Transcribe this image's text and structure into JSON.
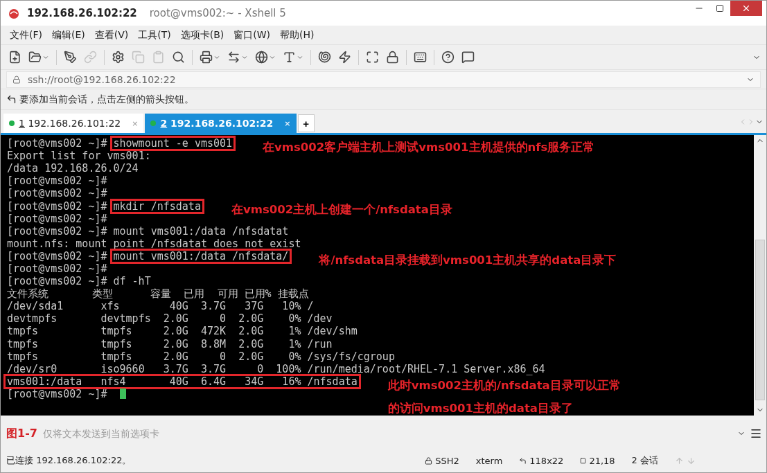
{
  "window": {
    "title": "192.168.26.102:22",
    "subtitle": "root@vms002:~ - Xshell 5"
  },
  "menu": [
    "文件(F)",
    "编辑(E)",
    "查看(V)",
    "工具(T)",
    "选项卡(B)",
    "窗口(W)",
    "帮助(H)"
  ],
  "address": {
    "value": "ssh://root@192.168.26.102:22"
  },
  "hint": "要添加当前会话，点击左侧的箭头按钮。",
  "tabs": [
    {
      "number": "1",
      "label": "192.168.26.101:22",
      "close": "×",
      "selected": false
    },
    {
      "number": "2",
      "label": "192.168.26.102:22",
      "close": "×",
      "selected": true
    }
  ],
  "add_tab": "+",
  "terminal": [
    {
      "prompt": "[root@vms002 ~]#",
      "command": "showmount -e vms001",
      "boxed": true,
      "note": [
        "在vms002客户端主机上测试vms001主机提供的nfs服务正常"
      ]
    },
    {
      "text": "Export list for vms001:",
      "boxed": false
    },
    {
      "text": "/data 192.168.26.0/24",
      "boxed": false
    },
    {
      "prompt": "[root@vms002 ~]#",
      "boxed": false
    },
    {
      "prompt": "[root@vms002 ~]#",
      "boxed": false
    },
    {
      "prompt": "[root@vms002 ~]#",
      "command": "mkdir /nfsdata",
      "boxed": true,
      "note": [
        "在vms002主机上创建一个/nfsdata目录"
      ]
    },
    {
      "prompt": "[root@vms002 ~]#",
      "boxed": false
    },
    {
      "prompt": "[root@vms002 ~]#",
      "command": "mount vms001:/data /nfsdatat",
      "boxed": false
    },
    {
      "text": "mount.nfs: mount point /nfsdatat does not exist",
      "boxed": false
    },
    {
      "prompt": "[root@vms002 ~]#",
      "command": "mount vms001:/data /nfsdata/",
      "boxed": true,
      "note": [
        "将/nfsdata目录挂载到vms001主机共享的data目录下"
      ]
    },
    {
      "prompt": "[root@vms002 ~]#",
      "boxed": false
    },
    {
      "prompt": "[root@vms002 ~]#",
      "command": "df -hT",
      "boxed": false
    },
    {
      "text": "文件系统       类型      容量  已用  可用 已用% 挂载点",
      "boxed": false
    },
    {
      "text": "/dev/sda1      xfs        40G  3.7G   37G   10% /",
      "boxed": false
    },
    {
      "text": "devtmpfs       devtmpfs  2.0G     0  2.0G    0% /dev",
      "boxed": false
    },
    {
      "text": "tmpfs          tmpfs     2.0G  472K  2.0G    1% /dev/shm",
      "boxed": false
    },
    {
      "text": "tmpfs          tmpfs     2.0G  8.8M  2.0G    1% /run",
      "boxed": false
    },
    {
      "text": "tmpfs          tmpfs     2.0G     0  2.0G    0% /sys/fs/cgroup",
      "boxed": false
    },
    {
      "text": "/dev/sr0       iso9660   3.7G  3.7G     0  100% /run/media/root/RHEL-7.1 Server.x86_64",
      "boxed": false
    },
    {
      "text": "vms001:/data   nfs4       40G  6.4G   34G   16% /nfsdata",
      "boxed": true,
      "note": [
        "此时vms002主机的/nfsdata目录可以正常",
        "的访问vms001主机的data目录了"
      ]
    },
    {
      "prompt": "[root@vms002 ~]#",
      "boxed": false,
      "cursor": true
    }
  ],
  "figure_label": "图1-7",
  "compose": {
    "placeholder": "仅将文本发送到当前选项卡"
  },
  "status": {
    "connection": "已连接 192.168.26.102:22。",
    "protocol": "SSH2",
    "terminal": "xterm",
    "size": "118x22",
    "cursor": "21,18",
    "sessions": "2 会话"
  }
}
